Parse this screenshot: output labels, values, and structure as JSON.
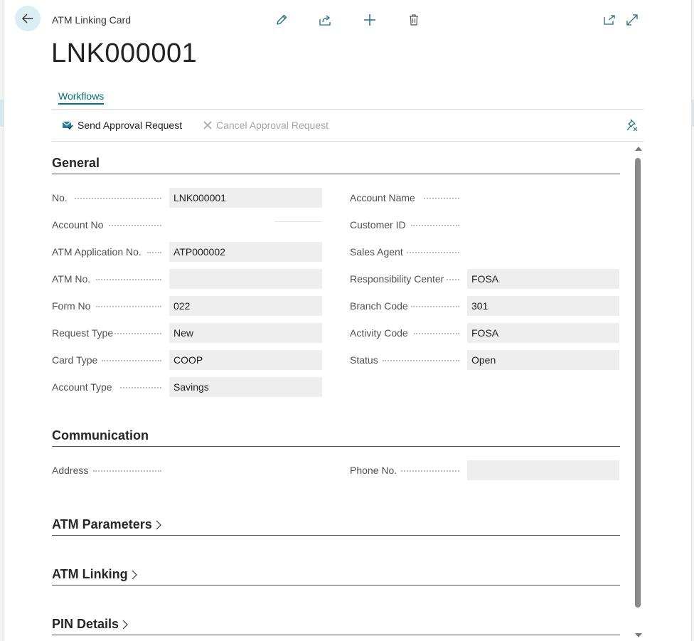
{
  "window": {
    "caption": "ATM Linking Card",
    "title": "LNK000001"
  },
  "toolbar": {
    "edit_icon": "pencil-icon",
    "share_icon": "share-icon",
    "new_icon": "plus-icon",
    "delete_icon": "trash-icon",
    "open_new_window_icon": "open-in-new-window-icon",
    "expand_icon": "expand-icon"
  },
  "tabs": [
    {
      "label": "Workflows"
    }
  ],
  "actions": {
    "send": "Send Approval Request",
    "cancel": "Cancel Approval Request"
  },
  "sections": {
    "general": "General",
    "communication": "Communication",
    "atm_parameters": "ATM Parameters",
    "atm_linking": "ATM Linking",
    "pin_details": "PIN Details"
  },
  "general": {
    "left": [
      {
        "label": "No.",
        "value": "LNK000001"
      },
      {
        "label": "Account No",
        "value": ""
      },
      {
        "label": "ATM Application No.",
        "value": "ATP000002"
      },
      {
        "label": "ATM No.",
        "value": ""
      },
      {
        "label": "Form No",
        "value": "022"
      },
      {
        "label": "Request Type",
        "value": "New"
      },
      {
        "label": "Card Type",
        "value": "COOP"
      },
      {
        "label": "Account Type",
        "value": "Savings"
      }
    ],
    "right": [
      {
        "label": "Account Name",
        "value": ""
      },
      {
        "label": "Customer ID",
        "value": ""
      },
      {
        "label": "Sales Agent",
        "value": ""
      },
      {
        "label": "Responsibility Center",
        "value": "FOSA"
      },
      {
        "label": "Branch Code",
        "value": "301"
      },
      {
        "label": "Activity Code",
        "value": "FOSA"
      },
      {
        "label": "Status",
        "value": "Open"
      }
    ]
  },
  "communication": {
    "address_label": "Address",
    "phone_label": "Phone No.",
    "phone_value": ""
  }
}
